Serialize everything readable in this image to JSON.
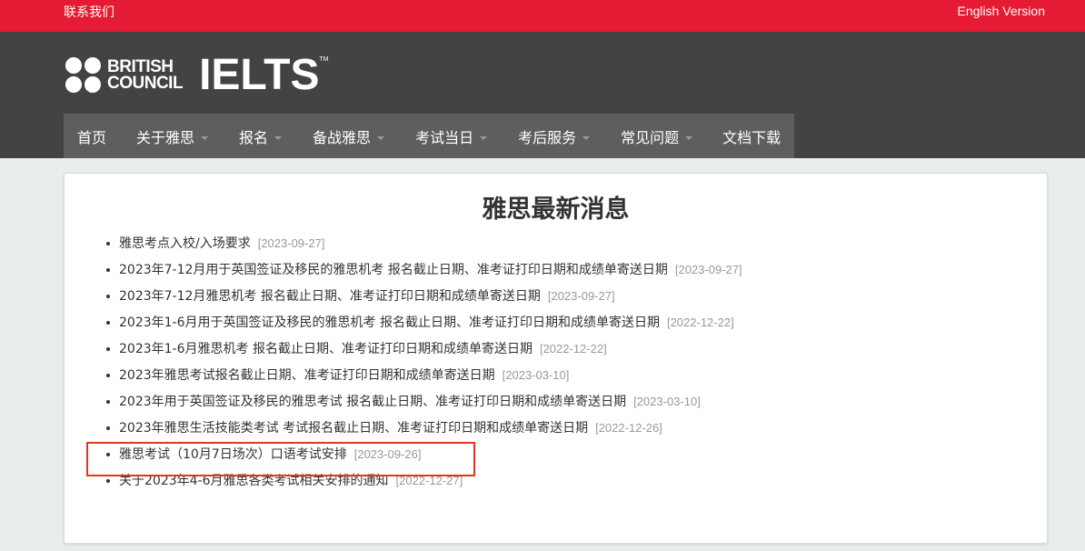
{
  "topbar": {
    "contact": "联系我们",
    "english": "English Version"
  },
  "logo": {
    "bc_line1": "BRITISH",
    "bc_line2": "COUNCIL",
    "ielts": "IELTS",
    "tm": "TM"
  },
  "nav": {
    "items": [
      {
        "label": "首页",
        "has_dropdown": false
      },
      {
        "label": "关于雅思",
        "has_dropdown": true
      },
      {
        "label": "报名",
        "has_dropdown": true
      },
      {
        "label": "备战雅思",
        "has_dropdown": true
      },
      {
        "label": "考试当日",
        "has_dropdown": true
      },
      {
        "label": "考后服务",
        "has_dropdown": true
      },
      {
        "label": "常见问题",
        "has_dropdown": true
      },
      {
        "label": "文档下载",
        "has_dropdown": false
      }
    ]
  },
  "main": {
    "title": "雅思最新消息",
    "news": [
      {
        "title": "雅思考点入校/入场要求",
        "date": "[2023-09-27]"
      },
      {
        "title": "2023年7-12月用于英国签证及移民的雅思机考 报名截止日期、准考证打印日期和成绩单寄送日期",
        "date": "[2023-09-27]"
      },
      {
        "title": "2023年7-12月雅思机考 报名截止日期、准考证打印日期和成绩单寄送日期",
        "date": "[2023-09-27]"
      },
      {
        "title": "2023年1-6月用于英国签证及移民的雅思机考 报名截止日期、准考证打印日期和成绩单寄送日期",
        "date": "[2022-12-22]"
      },
      {
        "title": "2023年1-6月雅思机考 报名截止日期、准考证打印日期和成绩单寄送日期",
        "date": "[2022-12-22]"
      },
      {
        "title": "2023年雅思考试报名截止日期、准考证打印日期和成绩单寄送日期",
        "date": "[2023-03-10]"
      },
      {
        "title": "2023年用于英国签证及移民的雅思考试 报名截止日期、准考证打印日期和成绩单寄送日期",
        "date": "[2023-03-10]"
      },
      {
        "title": "2023年雅思生活技能类考试 考试报名截止日期、准考证打印日期和成绩单寄送日期",
        "date": "[2022-12-26]"
      },
      {
        "title": "雅思考试（10月7日场次）口语考试安排",
        "date": "[2023-09-26]"
      },
      {
        "title": "关于2023年4-6月雅思各类考试相关安排的通知",
        "date": "[2022-12-27]"
      }
    ]
  },
  "colors": {
    "topbar": "#e41b33",
    "header": "#434345",
    "nav": "#5e5e61",
    "highlight": "#e2371f"
  }
}
